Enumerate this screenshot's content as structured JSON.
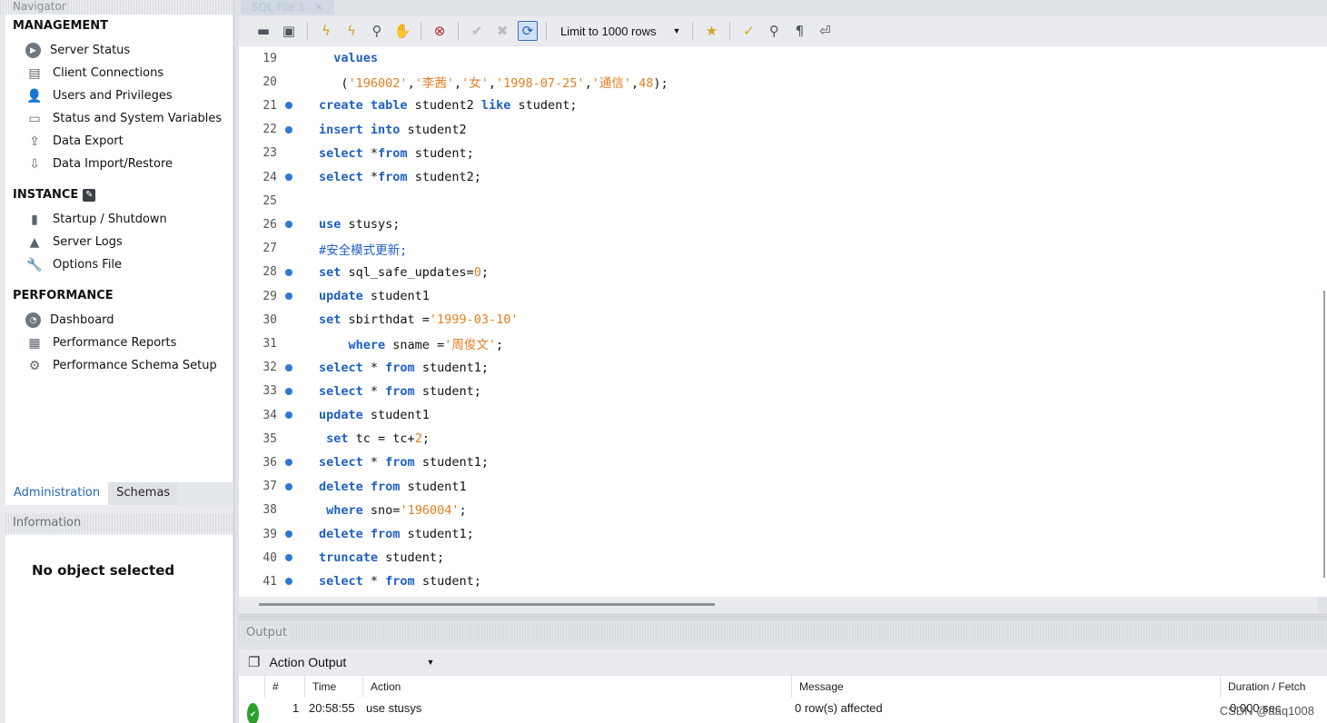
{
  "navigator": {
    "title": "Navigator",
    "management": {
      "title": "MANAGEMENT",
      "items": [
        "Server Status",
        "Client Connections",
        "Users and Privileges",
        "Status and System Variables",
        "Data Export",
        "Data Import/Restore"
      ]
    },
    "instance": {
      "title": "INSTANCE",
      "items": [
        "Startup / Shutdown",
        "Server Logs",
        "Options File"
      ]
    },
    "performance": {
      "title": "PERFORMANCE",
      "items": [
        "Dashboard",
        "Performance Reports",
        "Performance Schema Setup"
      ]
    },
    "tabs": [
      "Administration",
      "Schemas"
    ],
    "info_title": "Information",
    "no_object": "No object selected"
  },
  "editor": {
    "tab_label": "SQL File 1",
    "limit_label": "Limit to 1000 rows",
    "lines": [
      {
        "n": "19",
        "dot": false,
        "indent": "  ",
        "t": [
          [
            "kw",
            "values"
          ]
        ]
      },
      {
        "n": "20",
        "dot": false,
        "indent": "   ",
        "t": [
          [
            "id",
            "("
          ],
          [
            "str",
            "'196002'"
          ],
          [
            "id",
            ","
          ],
          [
            "str",
            "'李茜'"
          ],
          [
            "id",
            ","
          ],
          [
            "str",
            "'女'"
          ],
          [
            "id",
            ","
          ],
          [
            "str",
            "'1998-07-25'"
          ],
          [
            "id",
            ","
          ],
          [
            "str",
            "'通信'"
          ],
          [
            "id",
            ","
          ],
          [
            "num",
            "48"
          ],
          [
            "id",
            ");"
          ]
        ]
      },
      {
        "n": "21",
        "dot": true,
        "indent": "",
        "t": [
          [
            "kw",
            "create table "
          ],
          [
            "id",
            "student2 "
          ],
          [
            "kw",
            "like "
          ],
          [
            "id",
            "student;"
          ]
        ]
      },
      {
        "n": "22",
        "dot": true,
        "indent": "",
        "t": [
          [
            "kw",
            "insert into "
          ],
          [
            "id",
            "student2"
          ]
        ]
      },
      {
        "n": "23",
        "dot": false,
        "indent": "",
        "t": [
          [
            "kw",
            "select "
          ],
          [
            "id",
            "*"
          ],
          [
            "kw",
            "from "
          ],
          [
            "id",
            "student;"
          ]
        ]
      },
      {
        "n": "24",
        "dot": true,
        "indent": "",
        "t": [
          [
            "kw",
            "select "
          ],
          [
            "id",
            "*"
          ],
          [
            "kw",
            "from "
          ],
          [
            "id",
            "student2;"
          ]
        ]
      },
      {
        "n": "25",
        "dot": false,
        "indent": "",
        "t": []
      },
      {
        "n": "26",
        "dot": true,
        "indent": "",
        "t": [
          [
            "kw",
            "use "
          ],
          [
            "id",
            "stusys;"
          ]
        ]
      },
      {
        "n": "27",
        "dot": false,
        "indent": "",
        "t": [
          [
            "cm",
            "#安全模式更新;"
          ]
        ]
      },
      {
        "n": "28",
        "dot": true,
        "indent": "",
        "t": [
          [
            "kw",
            "set "
          ],
          [
            "id",
            "sql_safe_updates="
          ],
          [
            "num",
            "0"
          ],
          [
            "id",
            ";"
          ]
        ]
      },
      {
        "n": "29",
        "dot": true,
        "indent": "",
        "t": [
          [
            "kw",
            "update "
          ],
          [
            "id",
            "student1"
          ]
        ]
      },
      {
        "n": "30",
        "dot": false,
        "indent": "",
        "t": [
          [
            "kw",
            "set "
          ],
          [
            "id",
            "sbirthdat ="
          ],
          [
            "str",
            "'1999-03-10'"
          ]
        ]
      },
      {
        "n": "31",
        "dot": false,
        "indent": "    ",
        "t": [
          [
            "kw",
            "where "
          ],
          [
            "id",
            "sname ="
          ],
          [
            "str",
            "'周俊文'"
          ],
          [
            "id",
            ";"
          ]
        ]
      },
      {
        "n": "32",
        "dot": true,
        "indent": "",
        "t": [
          [
            "kw",
            "select "
          ],
          [
            "id",
            "* "
          ],
          [
            "kw",
            "from "
          ],
          [
            "id",
            "student1;"
          ]
        ]
      },
      {
        "n": "33",
        "dot": true,
        "indent": "",
        "t": [
          [
            "kw",
            "select "
          ],
          [
            "id",
            "* "
          ],
          [
            "kw",
            "from "
          ],
          [
            "id",
            "student;"
          ]
        ]
      },
      {
        "n": "34",
        "dot": true,
        "indent": "",
        "t": [
          [
            "kw",
            "update "
          ],
          [
            "id",
            "student1"
          ]
        ]
      },
      {
        "n": "35",
        "dot": false,
        "indent": " ",
        "t": [
          [
            "kw",
            "set "
          ],
          [
            "id",
            "tc = tc+"
          ],
          [
            "num",
            "2"
          ],
          [
            "id",
            ";"
          ]
        ]
      },
      {
        "n": "36",
        "dot": true,
        "indent": "",
        "t": [
          [
            "kw",
            "select "
          ],
          [
            "id",
            "* "
          ],
          [
            "kw",
            "from "
          ],
          [
            "id",
            "student1;"
          ]
        ]
      },
      {
        "n": "37",
        "dot": true,
        "indent": "",
        "t": [
          [
            "kw",
            "delete from "
          ],
          [
            "id",
            "student1"
          ]
        ]
      },
      {
        "n": "38",
        "dot": false,
        "indent": " ",
        "t": [
          [
            "kw",
            "where "
          ],
          [
            "id",
            "sno="
          ],
          [
            "str",
            "'196004'"
          ],
          [
            "id",
            ";"
          ]
        ]
      },
      {
        "n": "39",
        "dot": true,
        "indent": "",
        "t": [
          [
            "kw",
            "delete from "
          ],
          [
            "id",
            "student1;"
          ]
        ]
      },
      {
        "n": "40",
        "dot": true,
        "indent": "",
        "t": [
          [
            "kw",
            "truncate "
          ],
          [
            "id",
            "student;"
          ]
        ]
      },
      {
        "n": "41",
        "dot": true,
        "indent": "",
        "t": [
          [
            "kw",
            "select "
          ],
          [
            "id",
            "* "
          ],
          [
            "kw",
            "from "
          ],
          [
            "id",
            "student;"
          ]
        ]
      }
    ]
  },
  "output": {
    "title": "Output",
    "selector": "Action Output",
    "columns": [
      "#",
      "Time",
      "Action",
      "Message",
      "Duration / Fetch"
    ],
    "rows": [
      {
        "num": "1",
        "time": "20:58:55",
        "action": "use stusys",
        "message": "0 row(s) affected",
        "duration": "0.000 sec"
      }
    ]
  },
  "watermark": "CSDN @aaq1008",
  "colors": {
    "keyword": "#1f5fc6",
    "string": "#e67e22",
    "statement_dot": "#2f78d2",
    "ok": "#2aa02a"
  }
}
